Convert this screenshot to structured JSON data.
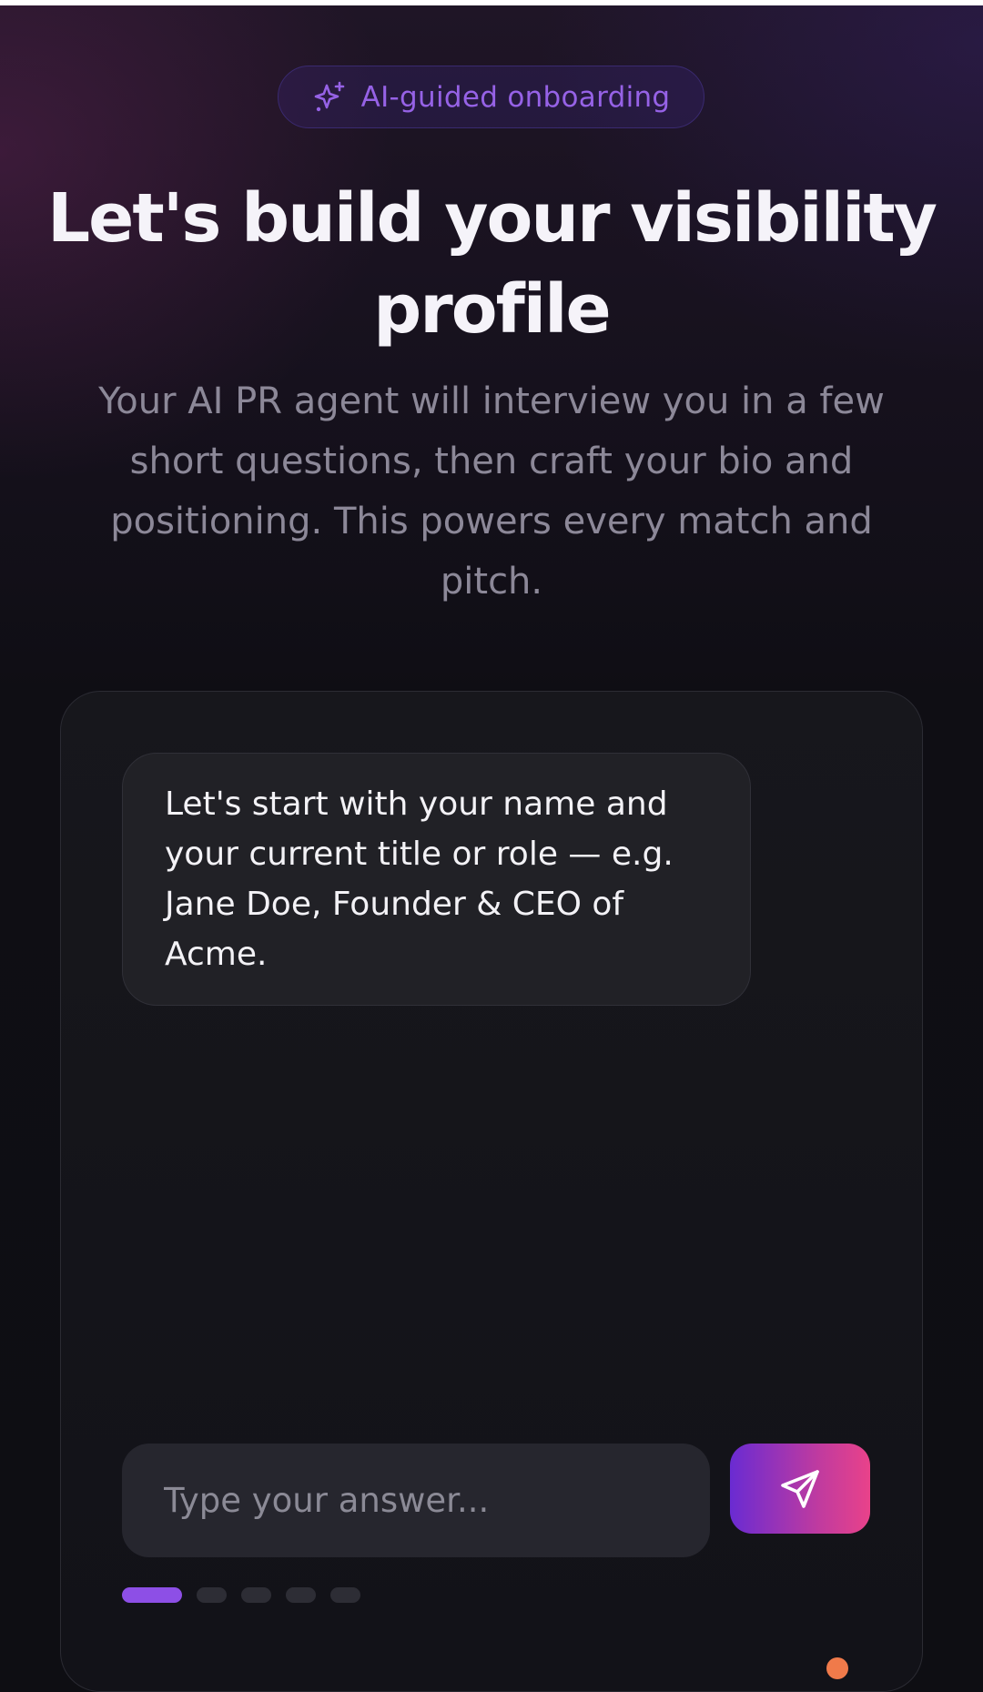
{
  "badge": {
    "icon": "sparkles-icon",
    "label": "AI-guided onboarding"
  },
  "hero": {
    "title": "Let's build your visibility profile",
    "subtitle": "Your AI PR agent will interview you in a few short questions, then craft your bio and positioning. This powers every match and pitch."
  },
  "chat": {
    "messages": [
      {
        "role": "assistant",
        "text": "Let's start with your name and your current title or role — e.g. Jane Doe, Founder & CEO of Acme."
      }
    ],
    "input": {
      "value": "",
      "placeholder": "Type your answer..."
    },
    "send_button": {
      "icon": "send-icon"
    },
    "progress": {
      "current_step": 1,
      "total_steps": 5
    }
  },
  "colors": {
    "accent": "#8d4fe6",
    "badge_text": "#9662e6",
    "send_gradient_start": "#6a2bd2",
    "send_gradient_end": "#e9428a"
  }
}
